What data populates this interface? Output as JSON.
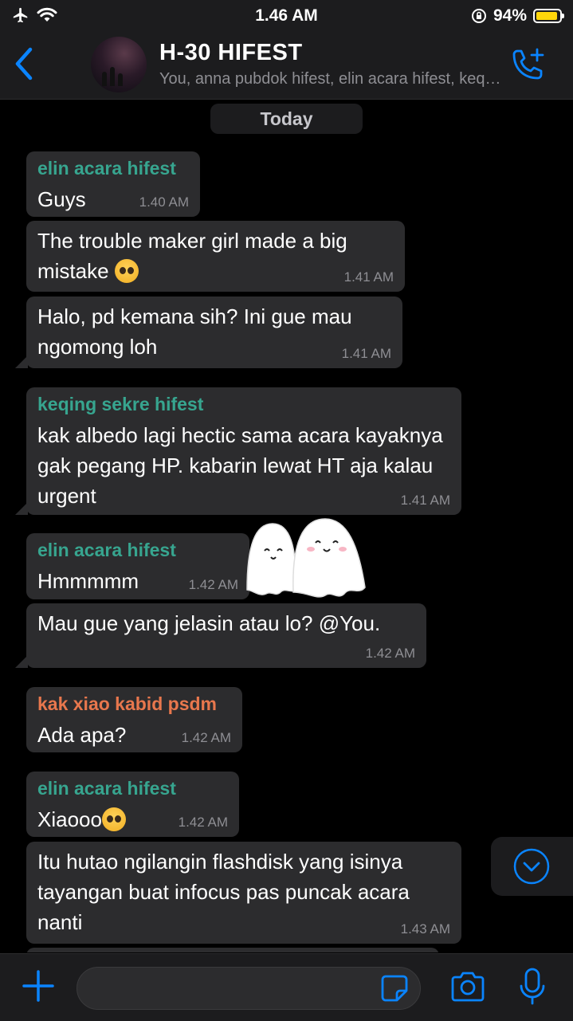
{
  "status": {
    "time": "1.46 AM",
    "battery": "94%",
    "battery_level": 0.94
  },
  "header": {
    "title": "H-30 HIFEST",
    "subtitle": "You, anna pubdok hifest, elin acara hifest, keqing sekre hifest, kak xiao kabid psdm"
  },
  "date_divider": "Today",
  "messages": [
    {
      "sender": "elin acara hifest",
      "text": "Guys",
      "time": "1.40 AM"
    },
    {
      "text": "The trouble maker girl made a big mistake",
      "time": "1.41 AM",
      "emoji": "pleading-face"
    },
    {
      "text": "Halo, pd kemana sih? Ini gue mau ngomong loh",
      "time": "1.41 AM"
    },
    {
      "sender": "keqing sekre hifest",
      "text": "kak albedo lagi hectic sama acara kayaknya gak pegang HP. kabarin lewat HT aja kalau urgent",
      "time": "1.41 AM"
    },
    {
      "sender": "elin acara hifest",
      "text": "Hmmmmm",
      "time": "1.42 AM"
    },
    {
      "text": "Mau gue yang jelasin atau lo? @You.",
      "time": "1.42 AM"
    },
    {
      "sender": "kak xiao kabid psdm",
      "text": "Ada apa?",
      "time": "1.42 AM"
    },
    {
      "sender": "elin acara hifest",
      "text": "Xiaooo",
      "time": "1.42 AM",
      "emoji": "pleading-face"
    },
    {
      "text": "Itu hutao ngilangin flashdisk yang isinya tayangan buat infocus pas puncak acara nanti",
      "time": "1.43 AM"
    }
  ],
  "colors": {
    "accent": "#0a84ff",
    "sender_green": "#37a58f",
    "sender_orange": "#e8774d",
    "bubble": "#2c2c2e"
  },
  "icons": [
    "airplane-icon",
    "wifi-icon",
    "orientation-lock-icon",
    "battery-icon",
    "back-chevron-icon",
    "add-call-icon",
    "ghost-sticker",
    "chevron-down-icon",
    "plus-icon",
    "sticker-icon",
    "camera-icon",
    "microphone-icon"
  ]
}
